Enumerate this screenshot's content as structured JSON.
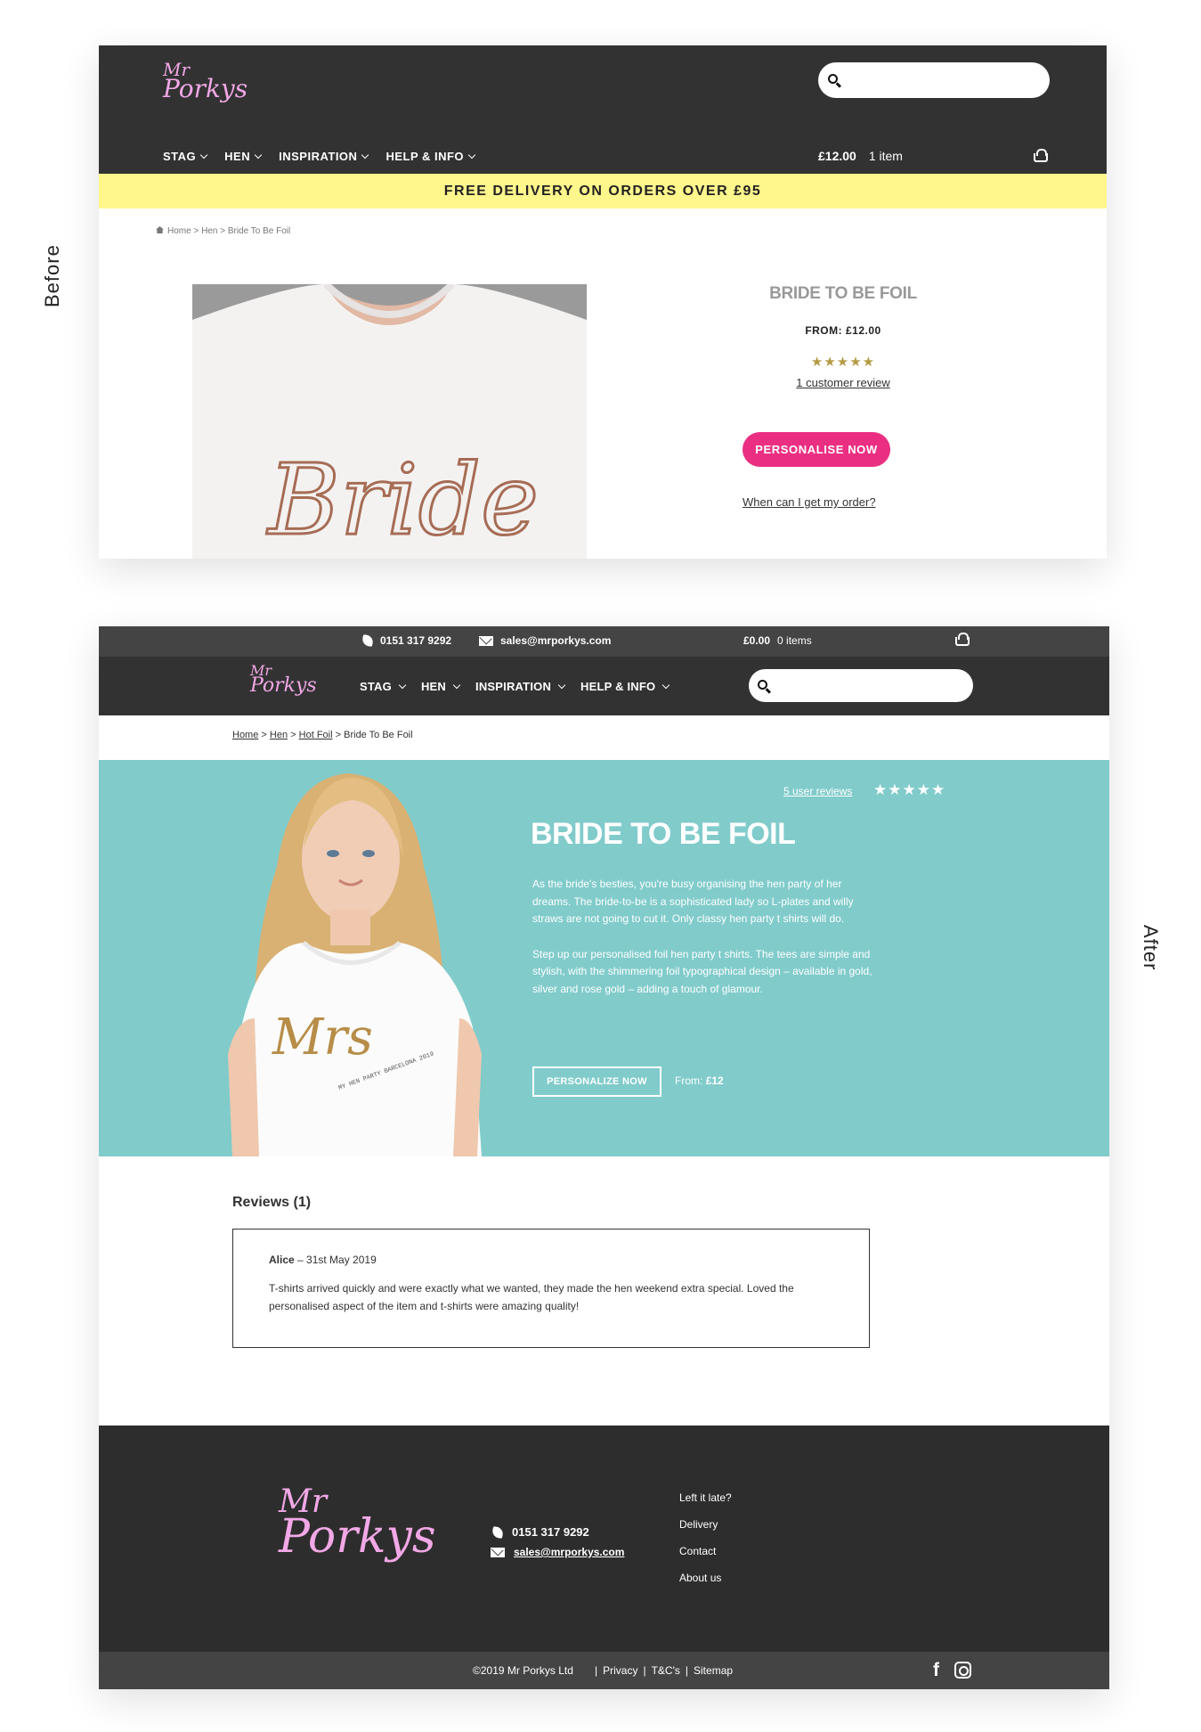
{
  "labels": {
    "before": "Before",
    "after": "After"
  },
  "before": {
    "logo": {
      "line1": "Mr",
      "line2": "Porkys"
    },
    "search": {
      "placeholder": ""
    },
    "nav": [
      "STAG",
      "HEN",
      "INSPIRATION",
      "HELP & INFO"
    ],
    "cart": {
      "total": "£12.00",
      "items": "1 item"
    },
    "banner": "FREE DELIVERY ON ORDERS OVER £95",
    "breadcrumb": "Home > Hen > Bride To Be Foil",
    "product": {
      "image_text": "Bride",
      "title": "BRIDE TO BE FOIL",
      "from": "FROM: £12.00",
      "rating": "★★★★★",
      "review_link": "1 customer review",
      "button": "PERSONALISE NOW",
      "delivery_link": "When can I get my order?"
    }
  },
  "after": {
    "topbar": {
      "phone": "0151 317 9292",
      "email": "sales@mrporkys.com",
      "total": "£0.00",
      "items": "0 items"
    },
    "logo": {
      "line1": "Mr",
      "line2": "Porkys"
    },
    "nav": [
      "STAG",
      "HEN",
      "INSPIRATION",
      "HELP & INFO"
    ],
    "search": {
      "placeholder": ""
    },
    "breadcrumb": {
      "home": "Home",
      "hen": "Hen",
      "hot_foil": "Hot Foil",
      "current": "Bride To Be Foil",
      "sep": ">"
    },
    "hero": {
      "shirt_text": "Mrs",
      "shirt_sub": "MY HEN PARTY BARCELONA 2019",
      "reviews_link": "5 user reviews",
      "rating": "★★★★★",
      "title": "BRIDE TO BE FOIL",
      "desc1": "As the bride's besties, you're busy organising the hen party of her dreams. The bride-to-be is a sophisticated lady so L-plates and willy straws are not going to cut it. Only classy hen party t shirts will do.",
      "desc2": "Step up our personalised foil hen party t shirts. The tees are simple and stylish, with the shimmering foil typographical design – available in gold, silver and rose gold – adding a touch of glamour.",
      "button": "PERSONALIZE NOW",
      "from_label": "From:",
      "from_price": "£12"
    },
    "reviews": {
      "heading": "Reviews (1)",
      "author": "Alice",
      "date": " – 31st May 2019",
      "text": "T-shirts arrived quickly and were exactly what we wanted, they made the hen weekend extra special. Loved the personalised aspect of the item and t-shirts were amazing quality!"
    },
    "footer": {
      "logo": {
        "line1": "Mr",
        "line2": "Porkys"
      },
      "phone": "0151 317 9292",
      "email": "sales@mrporkys.com",
      "links": [
        "Left it late?",
        "Delivery",
        "Contact",
        "About us"
      ],
      "copyright": "©2019 Mr Porkys Ltd",
      "legal": [
        "Privacy",
        "T&C's",
        "Sitemap"
      ],
      "separator": "|",
      "facebook": "f"
    }
  },
  "colors": {
    "dark": "#323232",
    "banner": "#fff68c",
    "pink": "#ea2f82",
    "teal": "#81cbcb",
    "logo": "#f2a8e6",
    "gold": "#b59a44"
  }
}
